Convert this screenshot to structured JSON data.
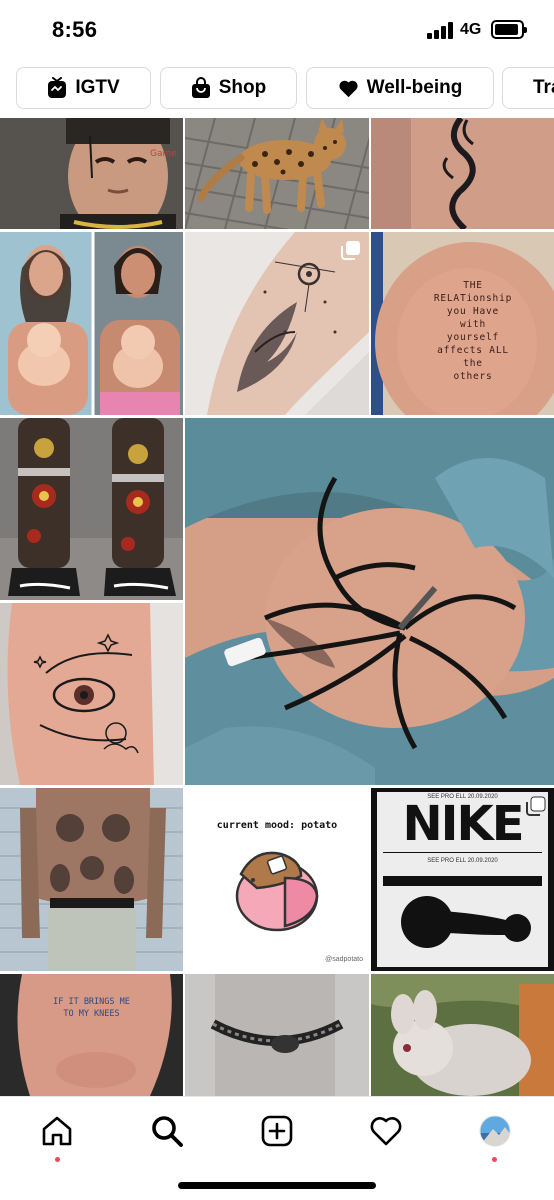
{
  "status_bar": {
    "time": "8:56",
    "network": "4G"
  },
  "topics": [
    {
      "label": "IGTV",
      "icon": "igtv-icon"
    },
    {
      "label": "Shop",
      "icon": "shopping-bag-icon"
    },
    {
      "label": "Well-being",
      "icon": "heart-icon"
    },
    {
      "label": "Tra",
      "icon": "none"
    }
  ],
  "posts": {
    "tattoo_quote": [
      "THE",
      "RELATionship",
      "you Have",
      "with",
      "yourself",
      "affects ALL",
      "the",
      "others"
    ],
    "potato_caption": "current mood: potato",
    "potato_credit": "@sadpotato",
    "nike_title": "NIKE",
    "nike_date": "SEE PRO ELL 20.09.2020",
    "knees_text": [
      "IF IT BRINGS ME",
      "TO MY KNEES"
    ]
  },
  "bottom_nav": [
    {
      "name": "home",
      "icon": "home-icon",
      "notification": true
    },
    {
      "name": "search",
      "icon": "search-icon",
      "active": true
    },
    {
      "name": "create",
      "icon": "create-post-icon"
    },
    {
      "name": "activity",
      "icon": "heart-outline-icon"
    },
    {
      "name": "profile",
      "icon": "profile-avatar",
      "notification": true
    }
  ],
  "colors": {
    "accent_dot": "#ed4956",
    "border": "#dbdbdb"
  }
}
